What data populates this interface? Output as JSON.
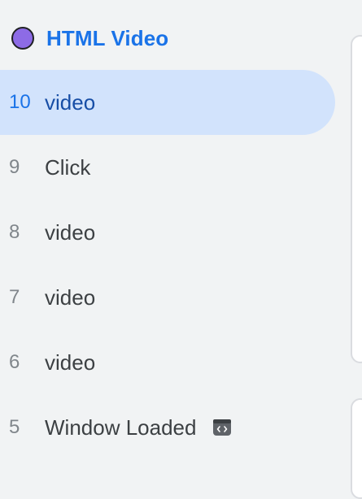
{
  "header": {
    "title": "HTML Video",
    "dot_color": "#8d6be6"
  },
  "events": [
    {
      "number": "10",
      "label": "video",
      "selected": true
    },
    {
      "number": "9",
      "label": "Click",
      "selected": false
    },
    {
      "number": "8",
      "label": "video",
      "selected": false
    },
    {
      "number": "7",
      "label": "video",
      "selected": false
    },
    {
      "number": "6",
      "label": "video",
      "selected": false
    },
    {
      "number": "5",
      "label": "Window Loaded",
      "selected": false,
      "icon": "code-icon"
    }
  ],
  "colors": {
    "accent": "#1a73e8",
    "selected_bg": "#d2e3fc",
    "background": "#f1f3f4"
  }
}
